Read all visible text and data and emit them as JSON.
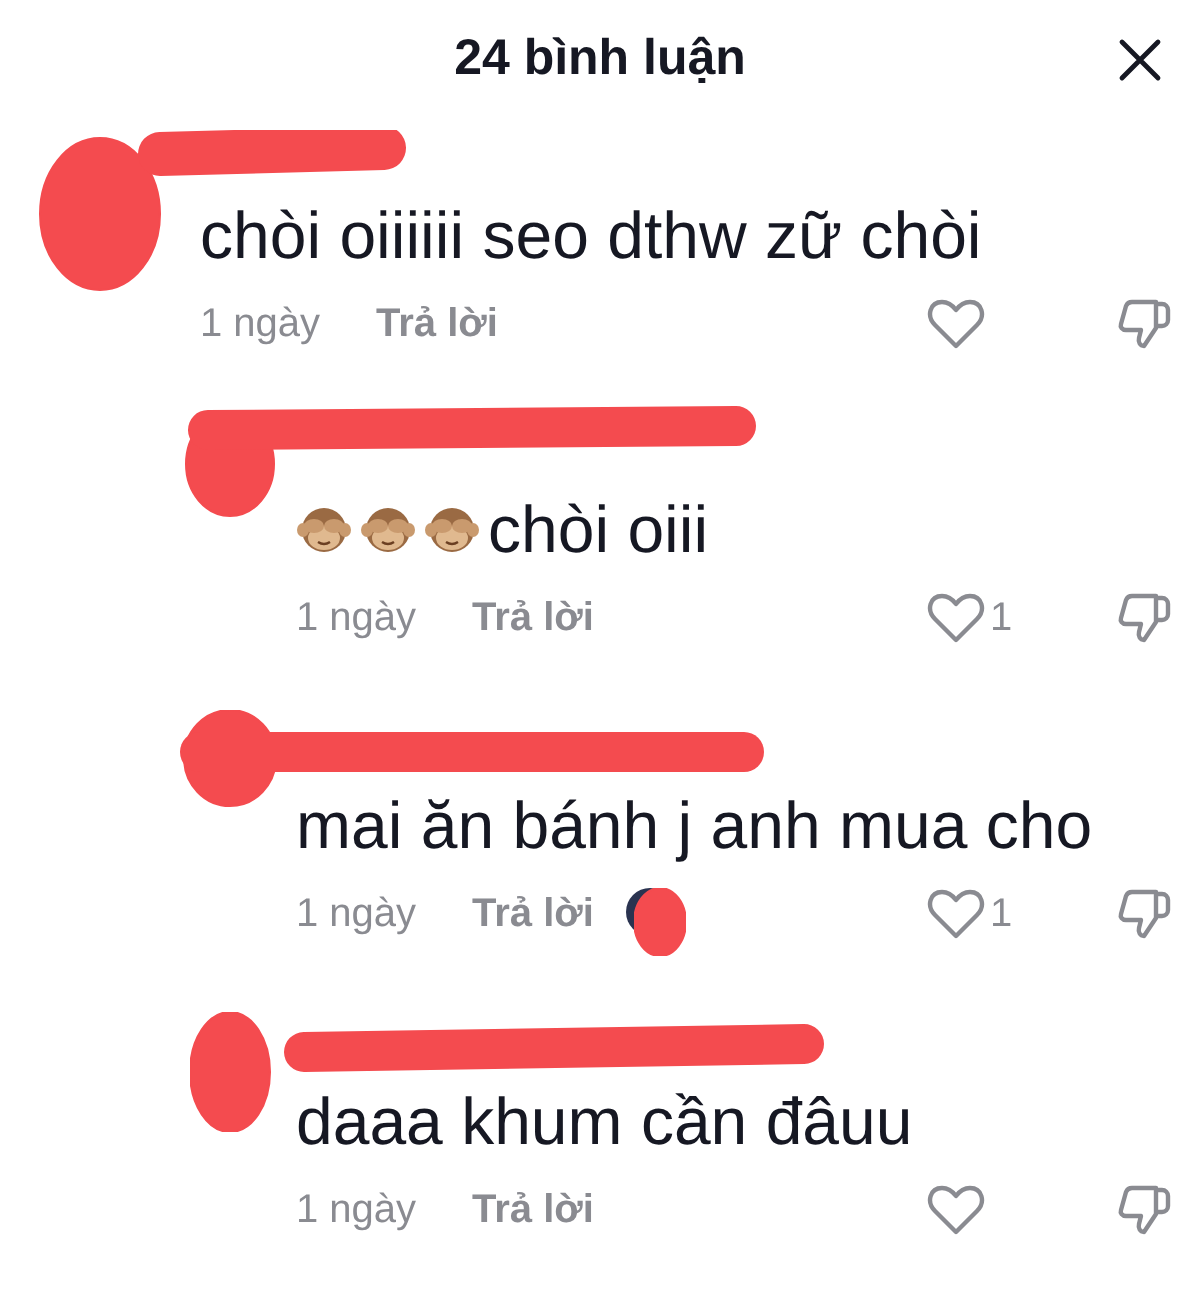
{
  "header": {
    "title": "24 bình luận"
  },
  "comments": [
    {
      "kind": "comment",
      "redacted": true,
      "text": "chòi oiiiiii seo dthw zữ chòi",
      "time": "1 ngày",
      "reply": "Trả lời",
      "liked": false,
      "liked_by_author": false
    },
    {
      "kind": "reply",
      "redacted": true,
      "emojis": [
        {
          "kind": "monkey"
        },
        {
          "kind": "monkey"
        },
        {
          "kind": "monkey"
        }
      ],
      "text": "chòi oiii",
      "time": "1 ngày",
      "reply": "Trả lời",
      "liked": false,
      "likes": "1",
      "liked_by_author": false
    },
    {
      "kind": "reply",
      "redacted": true,
      "text": "mai ăn bánh j anh mua cho",
      "time": "1 ngày",
      "reply": "Trả lời",
      "liked": false,
      "likes": "1",
      "liked_by_author": true
    },
    {
      "kind": "reply",
      "redacted": true,
      "text": "daaa khum cần đâuu",
      "time": "1 ngày",
      "reply": "Trả lời",
      "liked": false,
      "liked_by_author": false
    }
  ]
}
